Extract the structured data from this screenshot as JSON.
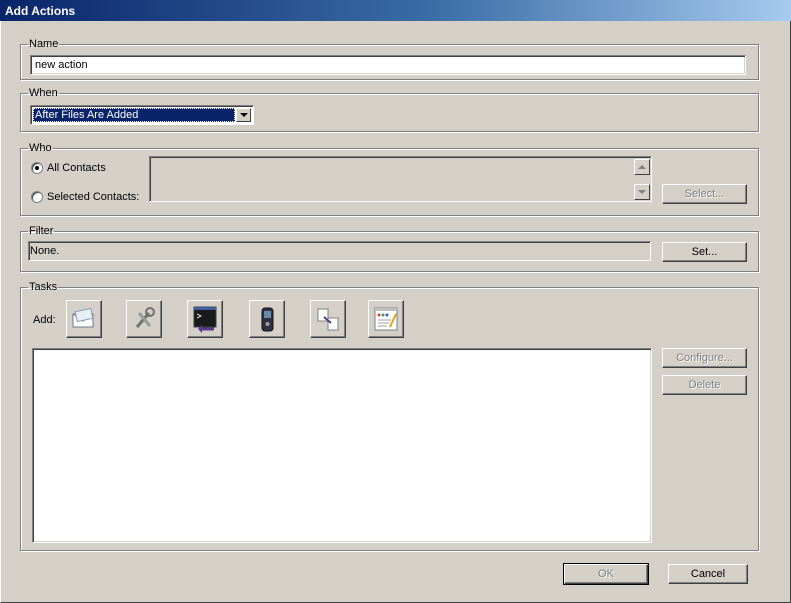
{
  "window": {
    "title": "Add Actions"
  },
  "name_group": {
    "legend": "Name",
    "value": "new action"
  },
  "when_group": {
    "legend": "When",
    "selected": "After Files Are Added"
  },
  "who_group": {
    "legend": "Who",
    "all_contacts_label": "All Contacts",
    "selected_contacts_label": "Selected Contacts:",
    "selected_option": "All Contacts",
    "select_button": "Select..."
  },
  "filter_group": {
    "legend": "Filter",
    "value": "None.",
    "set_button": "Set..."
  },
  "tasks_group": {
    "legend": "Tasks",
    "add_label": "Add:",
    "task_icons": [
      "email-task-icon",
      "tools-task-icon",
      "command-task-icon",
      "mobile-phone-task-icon",
      "copy-file-task-icon",
      "web-page-task-icon"
    ],
    "configure_button": "Configure...",
    "delete_button": "Delete"
  },
  "footer": {
    "ok_button": "OK",
    "cancel_button": "Cancel"
  },
  "colors": {
    "titlebar_start": "#0a246a",
    "titlebar_end": "#a6caf0",
    "face": "#d4d0c8",
    "selection": "#0a246a"
  }
}
